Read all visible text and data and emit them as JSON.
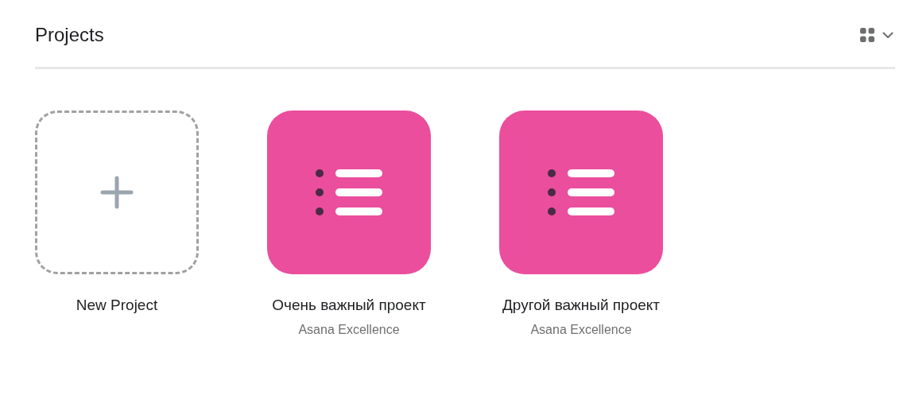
{
  "header": {
    "title": "Projects"
  },
  "projects": [
    {
      "kind": "new",
      "name": "New Project"
    },
    {
      "kind": "project",
      "name": "Очень важный проект",
      "team": "Asana Excellence"
    },
    {
      "kind": "project",
      "name": "Другой важный проект",
      "team": "Asana Excellence"
    }
  ]
}
